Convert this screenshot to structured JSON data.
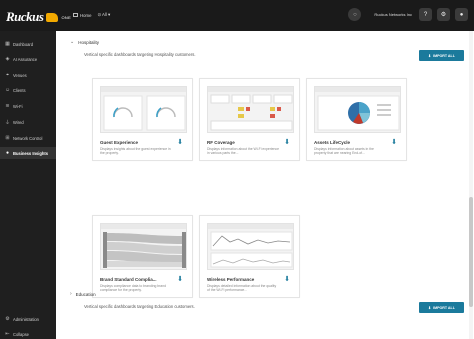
{
  "topbar": {
    "logo_text": "Ruckus",
    "logo_sub": "ONE",
    "crumb_home": "Home",
    "crumb_venue": "All",
    "org_name": "Ruckus Networks Inc",
    "icons": [
      "search-icon",
      "help-icon",
      "settings-icon",
      "user-icon"
    ]
  },
  "sidebar": {
    "items": [
      {
        "label": "Dashboard",
        "icon": "dashboard-icon"
      },
      {
        "label": "AI Assurance",
        "icon": "ai-icon"
      },
      {
        "label": "Venues",
        "icon": "location-icon"
      },
      {
        "label": "Clients",
        "icon": "clients-icon"
      },
      {
        "label": "Wi-Fi",
        "icon": "wifi-icon"
      },
      {
        "label": "Wired",
        "icon": "wired-icon"
      },
      {
        "label": "Network Control",
        "icon": "network-icon"
      },
      {
        "label": "Business Insights",
        "icon": "insights-icon",
        "active": true
      }
    ],
    "admin_label": "Administration",
    "collapse_label": "Collapse"
  },
  "hospitality": {
    "title": "Hospitality",
    "description": "Vertical specific dashboards targeting Hospitality customers.",
    "import_label": "IMPORT ALL",
    "cards": [
      {
        "title": "Guest Experience",
        "desc": "Displays insights about the guest experience in the property."
      },
      {
        "title": "RF Coverage",
        "desc": "Displays information about the Wi-Fi experience in various parts the..."
      },
      {
        "title": "Assets LifeCycle",
        "desc": "Displays information about assets in the property that are nearing End-of..."
      },
      {
        "title": "Brand Standard Complia...",
        "desc": "Displays compliance data to branding brand compliance for the property."
      },
      {
        "title": "Wireless Performance",
        "desc": "Displays detailed information about the quality of the Wi-Fi performance..."
      }
    ]
  },
  "education": {
    "title": "Education",
    "description": "Vertical specific dashboards targeting Education customers.",
    "import_label": "IMPORT ALL"
  },
  "colors": {
    "accent": "#1b7a9c",
    "topbar_bg": "#1a1a1a",
    "sidebar_bg": "#1f1f1f"
  }
}
